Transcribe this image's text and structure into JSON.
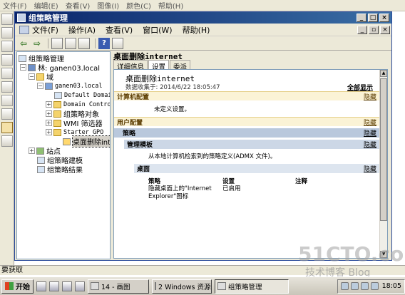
{
  "paint": {
    "menus": [
      "文件(F)",
      "编辑(E)",
      "查看(V)",
      "图像(I)",
      "颜色(C)",
      "帮助(H)"
    ],
    "status": "要获取"
  },
  "window": {
    "title": "组策略管理",
    "menus": [
      "文件(F)",
      "操作(A)",
      "查看(V)",
      "窗口(W)",
      "帮助(H)"
    ]
  },
  "tree": {
    "root": "组策略管理",
    "forest": "林: ganen03.local",
    "domains": "域",
    "domain": "ganen03.local",
    "default_domain": "Default Domain",
    "domain_controllers": "Domain Control",
    "gpo_objects": "组策略对象",
    "wmi_filters": "WMI 筛选器",
    "starter_gpo": "Starter GPO",
    "selected_gpo": "桌面删除int",
    "sites": "站点",
    "modeling": "组策略建模",
    "results": "组策略结果"
  },
  "right": {
    "title": "桌面删除internet",
    "tabs": [
      "详细信息",
      "设置",
      "委派"
    ],
    "report": {
      "title": "桌面删除internet",
      "collected": "数据收集于: 2014/6/22 18:05:47",
      "show_all": "全部显示",
      "computer_config": "计算机配置",
      "hide": "隐藏",
      "undefined": "未定义设置。",
      "user_config": "用户配置",
      "policies": "策略",
      "admin_templates": "管理模板",
      "admx_note": "从本地计算机检索到的策略定义(ADMX 文件)。",
      "desktop": "桌面",
      "col_policy": "策略",
      "col_setting": "设置",
      "col_comment": "注释",
      "row_policy": "隐藏桌面上的\"Internet Explorer\"图标",
      "row_setting": "已启用"
    }
  },
  "watermark": {
    "site": "51CTO.com",
    "sub": "技术博客  Blog"
  },
  "taskbar": {
    "start": "开始",
    "tasks": [
      "14 - 画图",
      "2 Windows 资源...",
      "组策略管理"
    ],
    "clock": "18:05"
  }
}
